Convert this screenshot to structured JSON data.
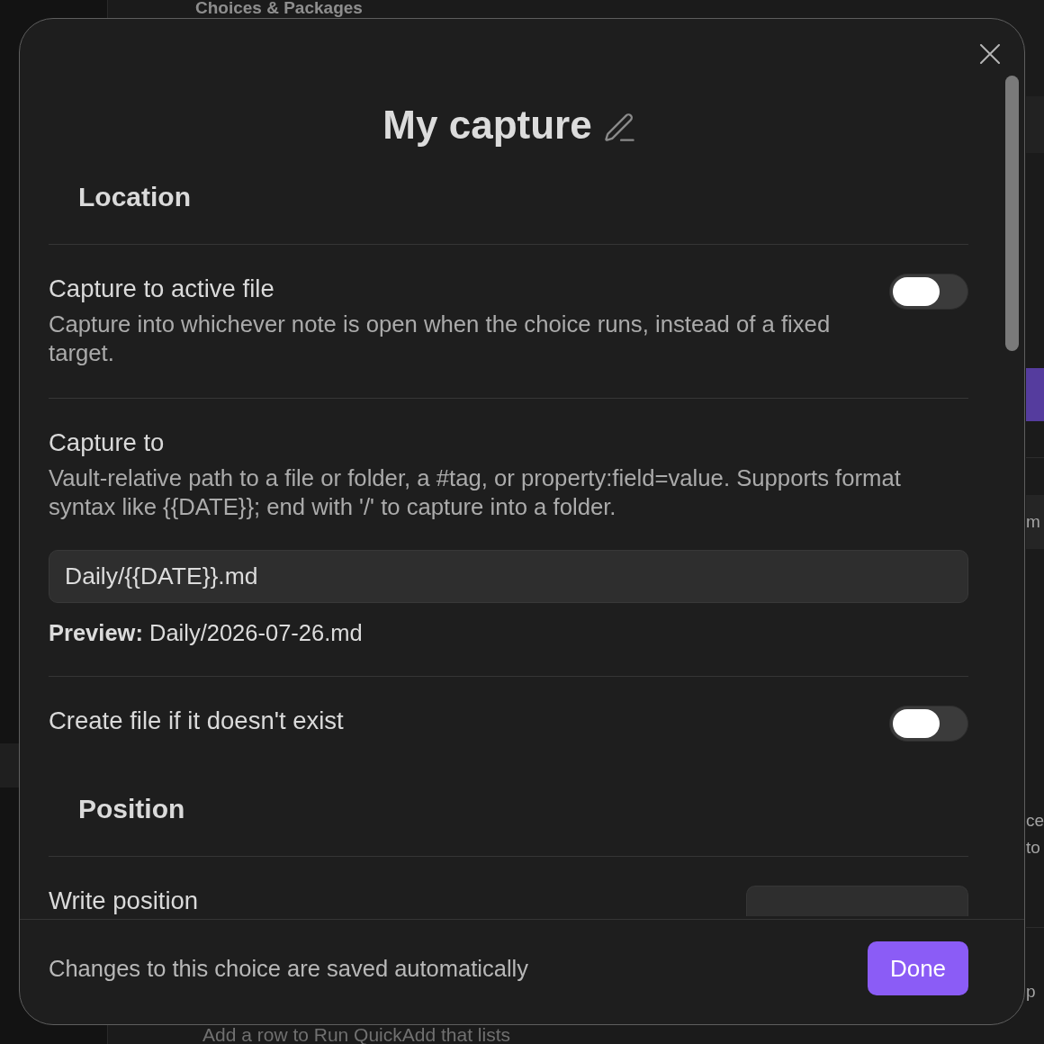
{
  "background": {
    "heading": "Choices & Packages",
    "edge_texts": [
      "m",
      "ce",
      "to",
      "p"
    ],
    "bottom_text": "Add a row to Run QuickAdd that lists"
  },
  "dialog": {
    "title": "My capture",
    "sections": [
      {
        "heading": "Location",
        "settings": [
          {
            "kind": "toggle",
            "label": "Capture to active file",
            "description": "Capture into whichever note is open when the choice runs, instead of a fixed target.",
            "on": false
          },
          {
            "kind": "path",
            "label": "Capture to",
            "description": "Vault-relative path to a file or folder, a #tag, or property:field=value. Supports format syntax like {{DATE}}; end with '/' to capture into a folder.",
            "value": "Daily/{{DATE}}.md",
            "preview": "**Preview:** Daily/2026-07-26.md"
          },
          {
            "kind": "toggle",
            "label": "Create file if it doesn't exist",
            "on": false
          }
        ]
      },
      {
        "heading": "Position",
        "settings": [
          {
            "kind": "dropdown",
            "label": "Write position"
          }
        ]
      }
    ],
    "footer": {
      "note": "Changes to this choice are saved automatically",
      "button": "Done"
    }
  }
}
